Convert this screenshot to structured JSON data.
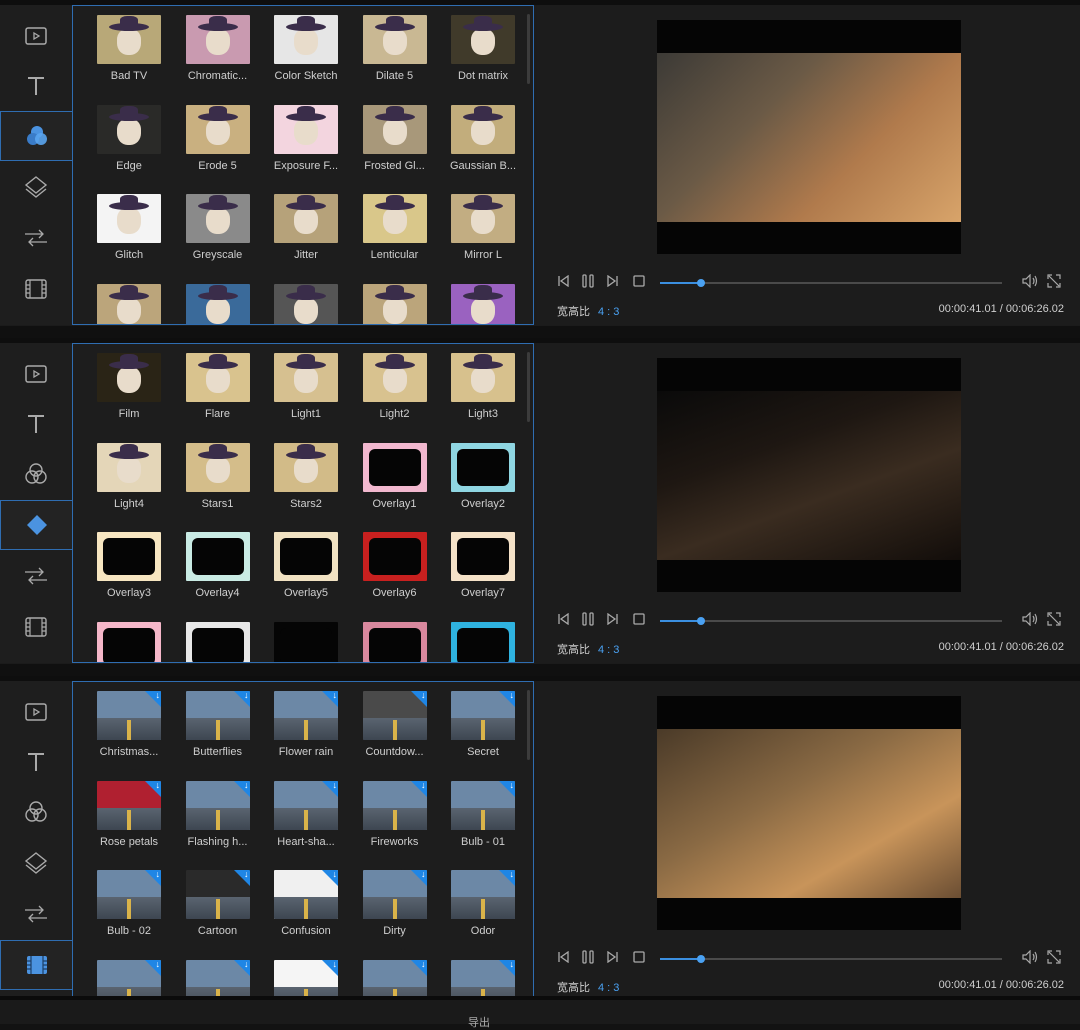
{
  "colors": {
    "accent": "#2f6db1",
    "progress": "#3b8fe0",
    "download_badge": "#1f86e5"
  },
  "sidebar_icons": [
    "video-icon",
    "text-icon",
    "filters-icon",
    "overlays-icon",
    "transitions-icon",
    "elements-icon"
  ],
  "panels": [
    {
      "active_tool": 2,
      "items": [
        {
          "label": "Bad TV",
          "bg": "#b8a878"
        },
        {
          "label": "Chromatic...",
          "bg": "#c99ab0"
        },
        {
          "label": "Color Sketch",
          "bg": "#e6e6e6"
        },
        {
          "label": "Dilate 5",
          "bg": "#c9b893"
        },
        {
          "label": "Dot matrix",
          "bg": "#403a2a"
        },
        {
          "label": "Edge",
          "bg": "#2a2a28"
        },
        {
          "label": "Erode 5",
          "bg": "#c9b080"
        },
        {
          "label": "Exposure F...",
          "bg": "#f3d5df"
        },
        {
          "label": "Frosted Gl...",
          "bg": "#a8987a"
        },
        {
          "label": "Gaussian B...",
          "bg": "#c2ad7c"
        },
        {
          "label": "Glitch",
          "bg": "#f4f4f4"
        },
        {
          "label": "Greyscale",
          "bg": "#8a8a8a"
        },
        {
          "label": "Jitter",
          "bg": "#b6a27a"
        },
        {
          "label": "Lenticular",
          "bg": "#d9c78a"
        },
        {
          "label": "Mirror L",
          "bg": "#c2ad82"
        },
        {
          "label": "",
          "bg": "#bba57b"
        },
        {
          "label": "",
          "bg": "#3a6a9a"
        },
        {
          "label": "",
          "bg": "#555555"
        },
        {
          "label": "",
          "bg": "#bba57b"
        },
        {
          "label": "",
          "bg": "#9a62c0"
        }
      ],
      "video_bg": "linear-gradient(135deg,#3c3a36 0%,#6b5a46 35%,#b07a4c 65%,#d8a46a 100%)"
    },
    {
      "active_tool": 3,
      "items": [
        {
          "label": "Film",
          "bg": "#2a2416"
        },
        {
          "label": "Flare",
          "bg": "#d9c38e"
        },
        {
          "label": "Light1",
          "bg": "#d6c090"
        },
        {
          "label": "Light2",
          "bg": "#d8c28f"
        },
        {
          "label": "Light3",
          "bg": "#d7c18d"
        },
        {
          "label": "Light4",
          "bg": "#e4d6b8"
        },
        {
          "label": "Stars1",
          "bg": "#d4bd8a"
        },
        {
          "label": "Stars2",
          "bg": "#d2bb88"
        },
        {
          "label": "Overlay1",
          "bg": "#f2b8cf"
        },
        {
          "label": "Overlay2",
          "bg": "#8fd6e2"
        },
        {
          "label": "Overlay3",
          "bg": "#f7e6c1"
        },
        {
          "label": "Overlay4",
          "bg": "#c9ebe4"
        },
        {
          "label": "Overlay5",
          "bg": "#f1e2c2"
        },
        {
          "label": "Overlay6",
          "bg": "#c8201f"
        },
        {
          "label": "Overlay7",
          "bg": "#f5e2c8"
        },
        {
          "label": "",
          "bg": "#f5b7c9"
        },
        {
          "label": "",
          "bg": "#e8e8e8"
        },
        {
          "label": "",
          "bg": "#050505"
        },
        {
          "label": "",
          "bg": "#d9889e"
        },
        {
          "label": "",
          "bg": "#2fb3e0"
        }
      ],
      "video_bg": "linear-gradient(160deg,#0a0a0a 0%,#1e1712 35%,#3a2c20 60%,#120d0a 100%)"
    },
    {
      "active_tool": 5,
      "items": [
        {
          "label": "Christmas...",
          "bg": "#6c88a6",
          "dl": true
        },
        {
          "label": "Butterflies",
          "bg": "#6c88a6",
          "dl": true
        },
        {
          "label": "Flower rain",
          "bg": "#6c88a6",
          "dl": true
        },
        {
          "label": "Countdow...",
          "bg": "#4a4a4a",
          "dl": true
        },
        {
          "label": "Secret",
          "bg": "#6c88a6",
          "dl": true
        },
        {
          "label": "Rose petals",
          "bg": "#b02030",
          "dl": true
        },
        {
          "label": "Flashing h...",
          "bg": "#6c88a6",
          "dl": true
        },
        {
          "label": "Heart-sha...",
          "bg": "#6c88a6",
          "dl": true
        },
        {
          "label": "Fireworks",
          "bg": "#6c88a6",
          "dl": true
        },
        {
          "label": "Bulb - 01",
          "bg": "#6c88a6",
          "dl": true
        },
        {
          "label": "Bulb - 02",
          "bg": "#6c88a6",
          "dl": true
        },
        {
          "label": "Cartoon",
          "bg": "#2a2a2a",
          "dl": true
        },
        {
          "label": "Confusion",
          "bg": "#f0f0f0",
          "dl": true
        },
        {
          "label": "Dirty",
          "bg": "#6c88a6",
          "dl": true
        },
        {
          "label": "Odor",
          "bg": "#6c88a6",
          "dl": true
        },
        {
          "label": "",
          "bg": "#6c88a6",
          "dl": true
        },
        {
          "label": "",
          "bg": "#6c88a6",
          "dl": true
        },
        {
          "label": "",
          "bg": "#f5f5f5",
          "dl": true
        },
        {
          "label": "",
          "bg": "#6c88a6",
          "dl": true
        },
        {
          "label": "",
          "bg": "#6c88a6",
          "dl": true
        }
      ],
      "video_bg": "linear-gradient(150deg,#4a3a28 0%,#8a6a44 40%,#c8945a 70%,#6b4e33 100%)"
    }
  ],
  "player": {
    "aspect_label": "宽高比",
    "aspect_value": "4 : 3",
    "timecode": "00:00:41.01 / 00:06:26.02",
    "progress": 0.12
  },
  "bottom": {
    "export_label": "导出"
  }
}
